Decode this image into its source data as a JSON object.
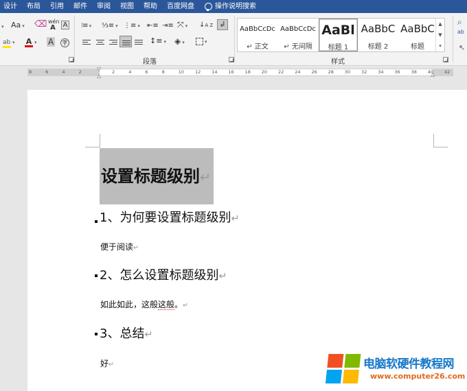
{
  "tabs": [
    "设计",
    "布局",
    "引用",
    "邮件",
    "审阅",
    "视图",
    "帮助",
    "百度网盘"
  ],
  "tell_me": "操作说明搜索",
  "ribbon": {
    "font_size_label": "Aa",
    "pinyin_label": "wén",
    "char_box_label": "A",
    "paragraph_group_label": "段落",
    "styles_group_label": "样式",
    "find_label": "ab"
  },
  "styles": [
    {
      "preview": "AaBbCcDc",
      "name": "↵ 正文"
    },
    {
      "preview": "AaBbCcDc",
      "name": "↵ 无间隔"
    },
    {
      "preview": "AaBl",
      "name": "标题 1"
    },
    {
      "preview": "AaBbC",
      "name": "标题 2"
    },
    {
      "preview": "AaBbC",
      "name": "标题"
    }
  ],
  "ruler_ticks": [
    "8",
    "6",
    "4",
    "2",
    "2",
    "4",
    "6",
    "8",
    "10",
    "12",
    "14",
    "16",
    "18",
    "20",
    "22",
    "24",
    "26",
    "28",
    "30",
    "32",
    "34",
    "36",
    "38",
    "40",
    "42"
  ],
  "document": {
    "title": "设置标题级别",
    "h2_1": "1、为何要设置标题级别",
    "body_1": "便于阅读",
    "h2_2": "2、怎么设置标题级别",
    "body_2_a": "如此如此，这般",
    "body_2_b": "这般",
    "body_2_c": "。",
    "h2_3": "3、总结",
    "body_3": "好",
    "return_mark": "↵"
  },
  "watermark": {
    "title": "电脑软硬件教程网",
    "url": "www.computer26.com",
    "colors": [
      "#f25022",
      "#7fba00",
      "#00a4ef",
      "#ffb900"
    ]
  }
}
